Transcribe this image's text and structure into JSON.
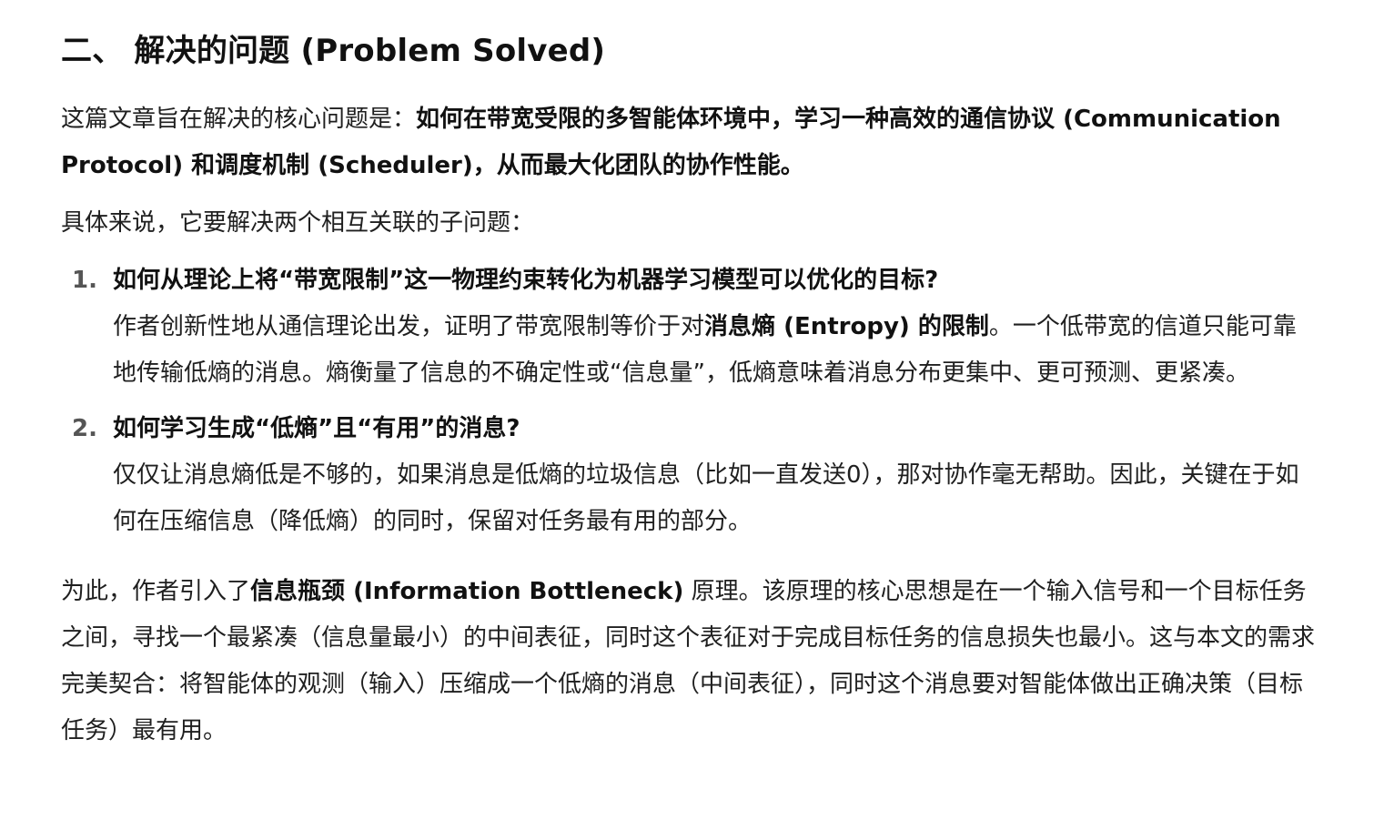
{
  "heading": "二、 解决的问题 (Problem Solved)",
  "intro": {
    "lead": "这篇文章旨在解决的核心问题是：",
    "bold": "如何在带宽受限的多智能体环境中，学习一种高效的通信协议 (Communication Protocol) 和调度机制 (Scheduler)，从而最大化团队的协作性能。"
  },
  "lead_in": "具体来说，它要解决两个相互关联的子问题：",
  "items": [
    {
      "number": "1.",
      "title": "如何从理论上将“带宽限制”这一物理约束转化为机器学习模型可以优化的目标?",
      "body_before": "作者创新性地从通信理论出发，证明了带宽限制等价于对",
      "body_bold": "消息熵 (Entropy) 的限制",
      "body_after": "。一个低带宽的信道只能可靠地传输低熵的消息。熵衡量了信息的不确定性或“信息量”，低熵意味着消息分布更集中、更可预测、更紧凑。"
    },
    {
      "number": "2.",
      "title": "如何学习生成“低熵”且“有用”的消息?",
      "body": "仅仅让消息熵低是不够的，如果消息是低熵的垃圾信息（比如一直发送0），那对协作毫无帮助。因此，关键在于如何在压缩信息（降低熵）的同时，保留对任务最有用的部分。"
    }
  ],
  "closing": {
    "before": "为此，作者引入了",
    "bold": "信息瓶颈 (Information Bottleneck)",
    "after": " 原理。该原理的核心思想是在一个输入信号和一个目标任务之间，寻找一个最紧凑（信息量最小）的中间表征，同时这个表征对于完成目标任务的信息损失也最小。这与本文的需求完美契合：将智能体的观测（输入）压缩成一个低熵的消息（中间表征），同时这个消息要对智能体做出正确决策（目标任务）最有用。"
  }
}
